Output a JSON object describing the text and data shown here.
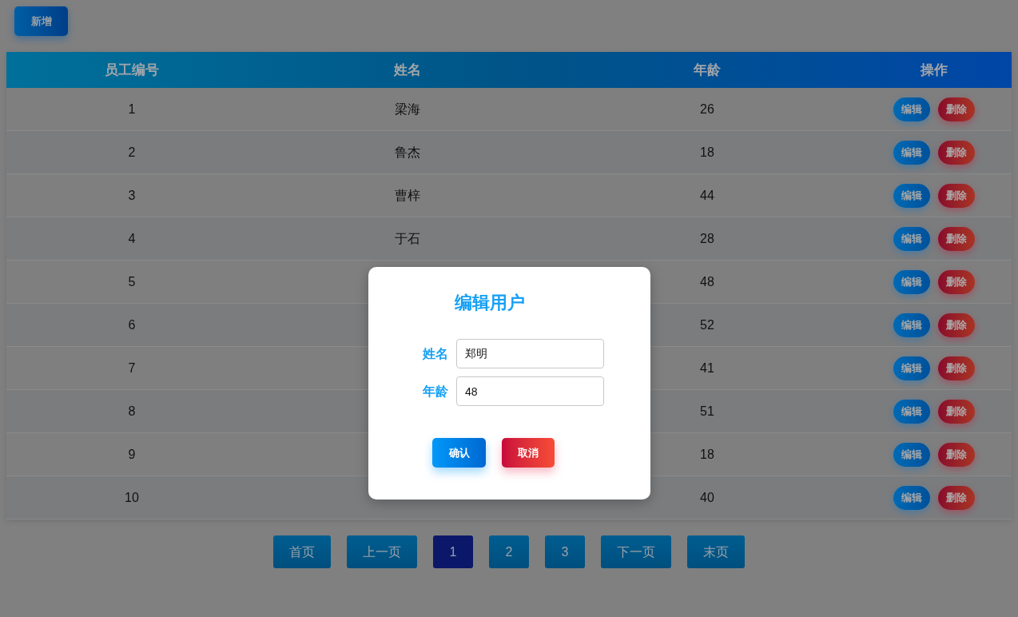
{
  "toolbar": {
    "add_button": "新增"
  },
  "table": {
    "columns": [
      "员工编号",
      "姓名",
      "年龄",
      "操作"
    ],
    "rows": [
      {
        "id": "1",
        "name": "梁海",
        "age": "26",
        "actions": [
          {
            "label": "编辑",
            "kind": "edit"
          },
          {
            "label": "删除",
            "kind": "delete"
          }
        ]
      },
      {
        "id": "2",
        "name": "鲁杰",
        "age": "18",
        "actions": [
          {
            "label": "编辑",
            "kind": "edit"
          },
          {
            "label": "删除",
            "kind": "delete"
          }
        ]
      },
      {
        "id": "3",
        "name": "曹梓",
        "age": "44",
        "actions": [
          {
            "label": "编辑",
            "kind": "edit"
          },
          {
            "label": "删除",
            "kind": "delete"
          }
        ]
      },
      {
        "id": "4",
        "name": "于石",
        "age": "28",
        "actions": [
          {
            "label": "编辑",
            "kind": "edit"
          },
          {
            "label": "删除",
            "kind": "delete"
          }
        ]
      },
      {
        "id": "5",
        "age": "48",
        "actions": [
          {
            "label": "编辑",
            "kind": "edit"
          },
          {
            "label": "删除",
            "kind": "delete"
          }
        ]
      },
      {
        "id": "6",
        "age": "52",
        "actions": [
          {
            "label": "编辑",
            "kind": "edit"
          },
          {
            "label": "删除",
            "kind": "delete"
          }
        ]
      },
      {
        "id": "7",
        "age": "41",
        "actions": [
          {
            "label": "编辑",
            "kind": "edit"
          },
          {
            "label": "删除",
            "kind": "delete"
          }
        ]
      },
      {
        "id": "8",
        "age": "51",
        "actions": [
          {
            "label": "编辑",
            "kind": "edit"
          },
          {
            "label": "删除",
            "kind": "delete"
          }
        ]
      },
      {
        "id": "9",
        "age": "18",
        "actions": [
          {
            "label": "编辑",
            "kind": "edit"
          },
          {
            "label": "删除",
            "kind": "delete"
          }
        ]
      },
      {
        "id": "10",
        "age": "40",
        "actions": [
          {
            "label": "编辑",
            "kind": "edit"
          },
          {
            "label": "删除",
            "kind": "delete"
          }
        ]
      }
    ]
  },
  "pagination": [
    {
      "label": "首页",
      "selected": false
    },
    {
      "label": "上一页",
      "selected": false
    },
    {
      "label": "1",
      "selected": true
    },
    {
      "label": "2",
      "selected": false
    },
    {
      "label": "3",
      "selected": false
    },
    {
      "label": "下一页",
      "selected": false
    },
    {
      "label": "末页",
      "selected": false
    }
  ],
  "dialog": {
    "title": "编辑用户",
    "fields": [
      {
        "label": "姓名",
        "value": "郑明"
      },
      {
        "label": "年龄",
        "value": "48"
      }
    ],
    "buttons": [
      {
        "label": "确认",
        "kind": "confirm"
      },
      {
        "label": "取消",
        "kind": "cancel"
      }
    ]
  }
}
